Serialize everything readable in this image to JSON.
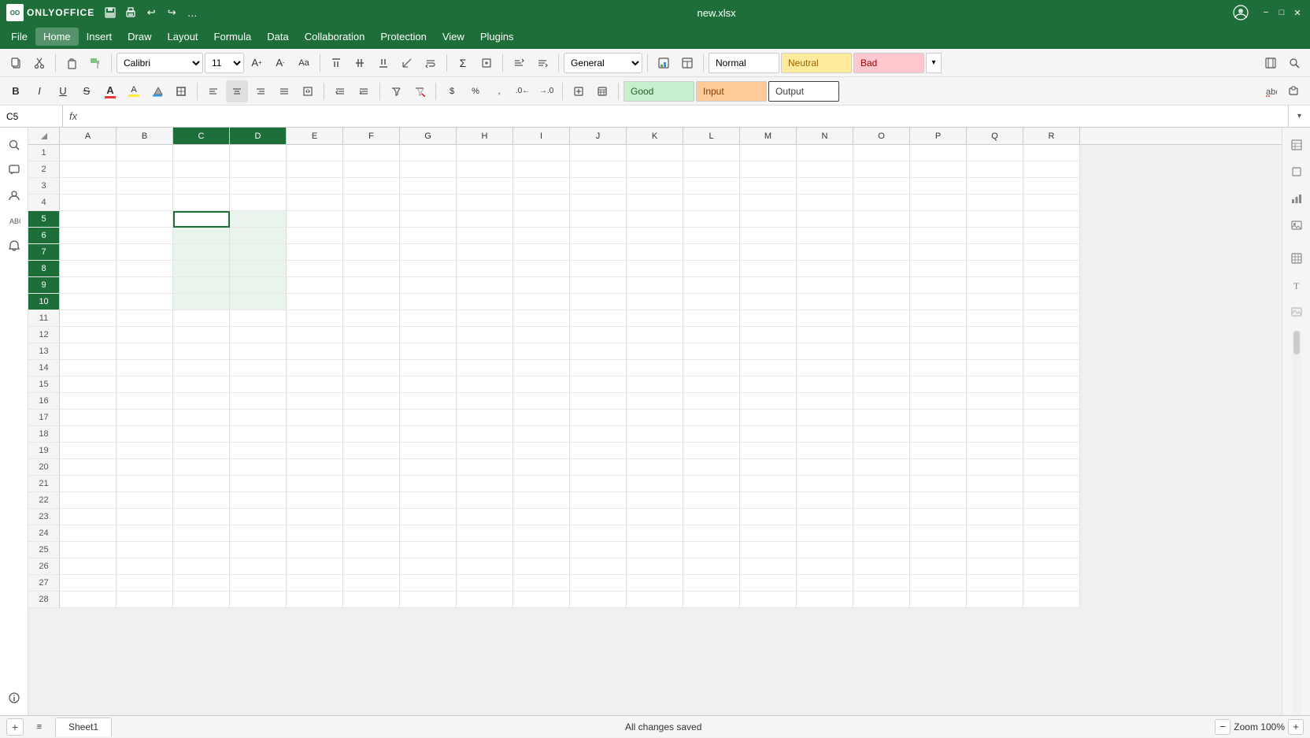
{
  "app": {
    "logo": "OO",
    "name": "ONLYOFFICE",
    "filename": "new.xlsx"
  },
  "title_bar": {
    "save_icon": "💾",
    "print_icon": "🖨",
    "undo_icon": "↩",
    "redo_icon": "↪",
    "more_icon": "…",
    "user_icon": "👤",
    "minimize_icon": "−",
    "maximize_icon": "□",
    "close_icon": "✕"
  },
  "menu": {
    "items": [
      "File",
      "Home",
      "Insert",
      "Draw",
      "Layout",
      "Formula",
      "Data",
      "Collaboration",
      "Protection",
      "View",
      "Plugins"
    ]
  },
  "toolbar1": {
    "font": "Calibri",
    "font_size": "11",
    "cell_styles": {
      "normal": {
        "label": "Normal",
        "style": "normal"
      },
      "neutral": {
        "label": "Neutral",
        "style": "neutral"
      },
      "bad": {
        "label": "Bad",
        "style": "bad"
      },
      "good": {
        "label": "Good",
        "style": "good"
      },
      "input": {
        "label": "Input",
        "style": "input"
      },
      "output": {
        "label": "Output",
        "style": "output"
      }
    }
  },
  "formula_bar": {
    "cell_ref": "C5",
    "fx_label": "fx"
  },
  "grid": {
    "columns": [
      "A",
      "B",
      "C",
      "D",
      "E",
      "F",
      "G",
      "H",
      "I",
      "J",
      "K",
      "L",
      "M",
      "N",
      "O",
      "P",
      "Q",
      "R"
    ],
    "rows": [
      1,
      2,
      3,
      4,
      5,
      6,
      7,
      8,
      9,
      10,
      11,
      12,
      13,
      14,
      15,
      16,
      17,
      18,
      19,
      20,
      21,
      22,
      23,
      24,
      25,
      26,
      27,
      28
    ],
    "selected_cell": "C5",
    "selected_range_start": {
      "row": 5,
      "col": 3
    },
    "selected_range_end": {
      "row": 10,
      "col": 4
    }
  },
  "status_bar": {
    "message": "All changes saved",
    "zoom_label": "Zoom 100%",
    "zoom_percent": 100
  },
  "sheet_tabs": [
    {
      "label": "Sheet1",
      "active": true
    }
  ],
  "right_panel": {
    "icons": [
      "📐",
      "⬜",
      "📊",
      "🔲",
      "≡",
      "ℹ"
    ]
  }
}
